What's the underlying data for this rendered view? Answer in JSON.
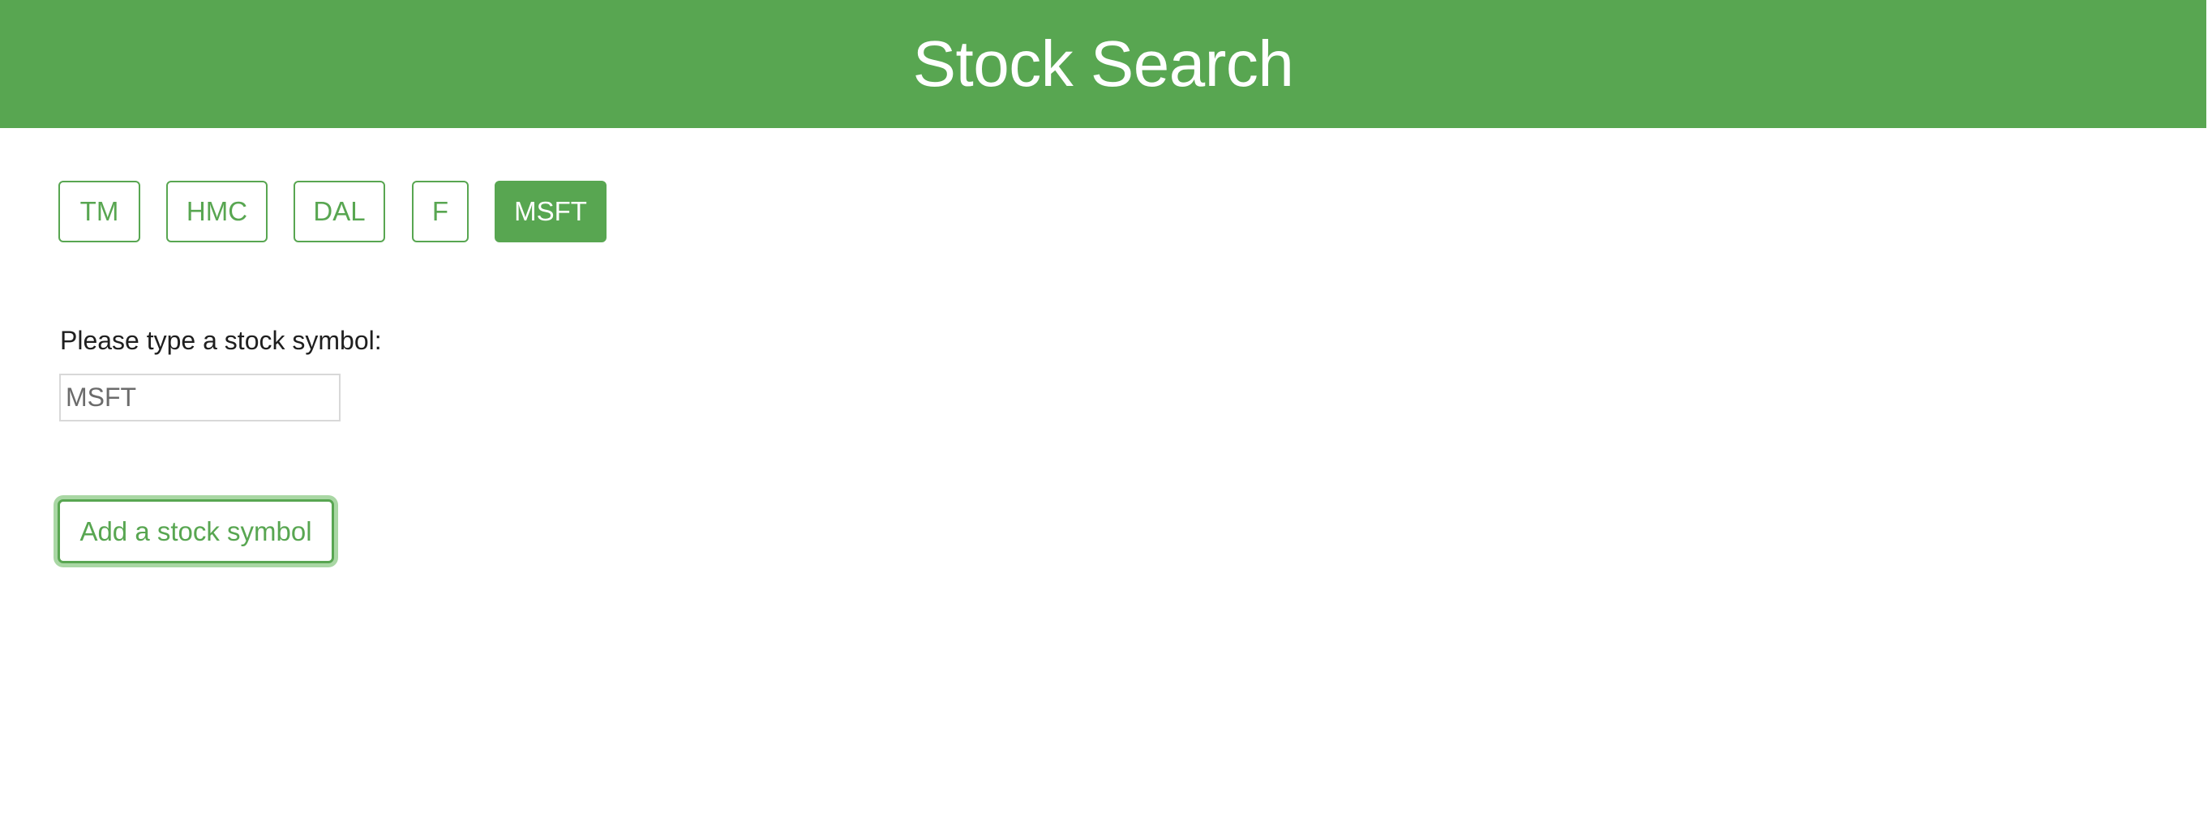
{
  "header": {
    "title": "Stock Search"
  },
  "symbols": [
    {
      "label": "TM",
      "active": false
    },
    {
      "label": "HMC",
      "active": false
    },
    {
      "label": "DAL",
      "active": false
    },
    {
      "label": "F",
      "active": false
    },
    {
      "label": "MSFT",
      "active": true
    }
  ],
  "form": {
    "prompt": "Please type a stock symbol:",
    "input_value": "MSFT",
    "add_label": "Add a stock symbol"
  },
  "colors": {
    "accent": "#58a651",
    "focus_ring": "#a9d7a4",
    "input_border": "#d8d8d8"
  }
}
